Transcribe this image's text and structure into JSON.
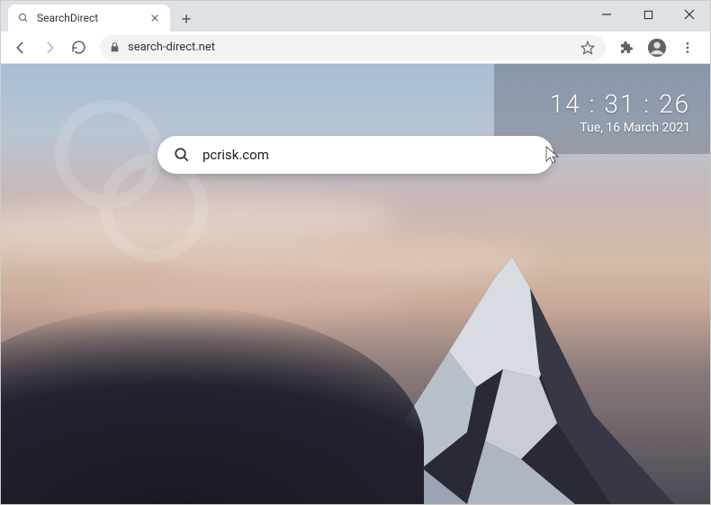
{
  "tab": {
    "title": "SearchDirect"
  },
  "url": "search-direct.net",
  "clock": {
    "time": "14 : 31 : 26",
    "date": "Tue, 16 March 2021"
  },
  "search": {
    "value": "pcrisk.com"
  }
}
